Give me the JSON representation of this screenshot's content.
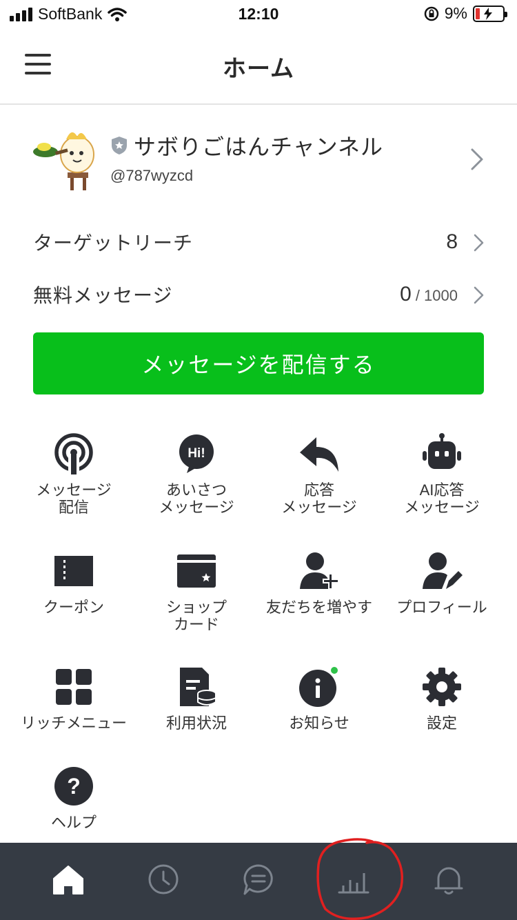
{
  "status_bar": {
    "carrier": "SoftBank",
    "time": "12:10",
    "battery": "9%"
  },
  "header": {
    "title": "ホーム"
  },
  "account": {
    "name": "サボりごはんチャンネル",
    "id": "@787wyzcd"
  },
  "stats": {
    "target_reach_label": "ターゲットリーチ",
    "target_reach_value": "8",
    "free_messages_label": "無料メッセージ",
    "free_messages_used": "0",
    "free_messages_limit": "/ 1000"
  },
  "cta": {
    "label": "メッセージを配信する"
  },
  "menu": [
    {
      "icon": "broadcast-icon",
      "line1": "メッセージ",
      "line2": "配信"
    },
    {
      "icon": "greeting-icon",
      "line1": "あいさつ",
      "line2": "メッセージ"
    },
    {
      "icon": "reply-icon",
      "line1": "応答",
      "line2": "メッセージ"
    },
    {
      "icon": "robot-icon",
      "line1": "AI応答",
      "line2": "メッセージ"
    },
    {
      "icon": "coupon-icon",
      "line1": "クーポン",
      "line2": ""
    },
    {
      "icon": "shop-card-icon",
      "line1": "ショップ",
      "line2": "カード"
    },
    {
      "icon": "add-friend-icon",
      "line1": "友だちを増やす",
      "line2": ""
    },
    {
      "icon": "profile-icon",
      "line1": "プロフィール",
      "line2": ""
    },
    {
      "icon": "rich-menu-icon",
      "line1": "リッチメニュー",
      "line2": ""
    },
    {
      "icon": "usage-icon",
      "line1": "利用状況",
      "line2": ""
    },
    {
      "icon": "info-icon",
      "line1": "お知らせ",
      "line2": ""
    },
    {
      "icon": "gear-icon",
      "line1": "設定",
      "line2": ""
    },
    {
      "icon": "help-icon",
      "line1": "ヘルプ",
      "line2": ""
    }
  ],
  "bottom_nav": [
    "home-icon",
    "clock-icon",
    "chat-icon",
    "chart-icon",
    "bell-icon"
  ],
  "colors": {
    "accent": "#08bf1b",
    "nav_bg": "#353b44",
    "icon": "#2b2d33",
    "annotation": "#e02020"
  }
}
